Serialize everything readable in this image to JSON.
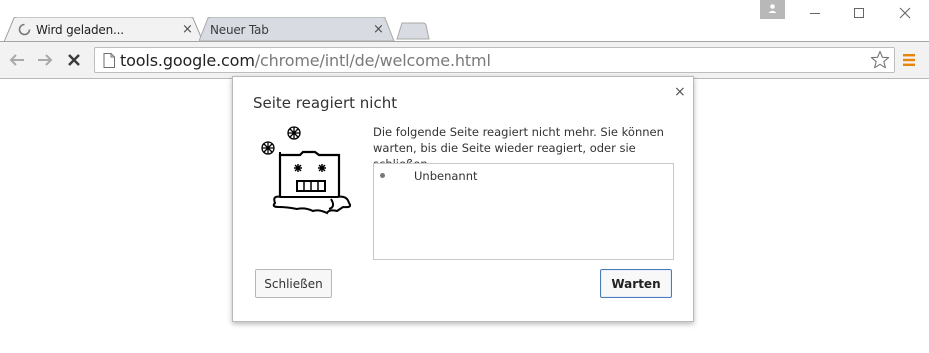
{
  "tabs": [
    {
      "title": "Wird geladen...",
      "state": "active-loading",
      "close": "×"
    },
    {
      "title": "Neuer Tab",
      "state": "inactive",
      "close": "×"
    }
  ],
  "window_controls": {
    "profile": "profile-icon",
    "minimize": "minimize-icon",
    "maximize": "maximize-icon",
    "close": "close-icon"
  },
  "toolbar": {
    "back": "back-arrow-icon",
    "forward": "forward-arrow-icon",
    "stop": "stop-icon",
    "url_host": "tools.google.com",
    "url_path": "/chrome/intl/de/welcome.html",
    "bookmark": "star-icon",
    "menu": "hamburger-menu-icon",
    "menu_color": "#e8860b"
  },
  "dialog": {
    "title": "Seite reagiert nicht",
    "close": "×",
    "message": "Die folgende Seite reagiert nicht mehr. Sie können warten, bis die Seite wieder reagiert, oder sie schließen.",
    "pages": [
      "Unbenannt"
    ],
    "button_close": "Schließen",
    "button_wait": "Warten",
    "illustration": "hung-page-folder-illustration"
  }
}
